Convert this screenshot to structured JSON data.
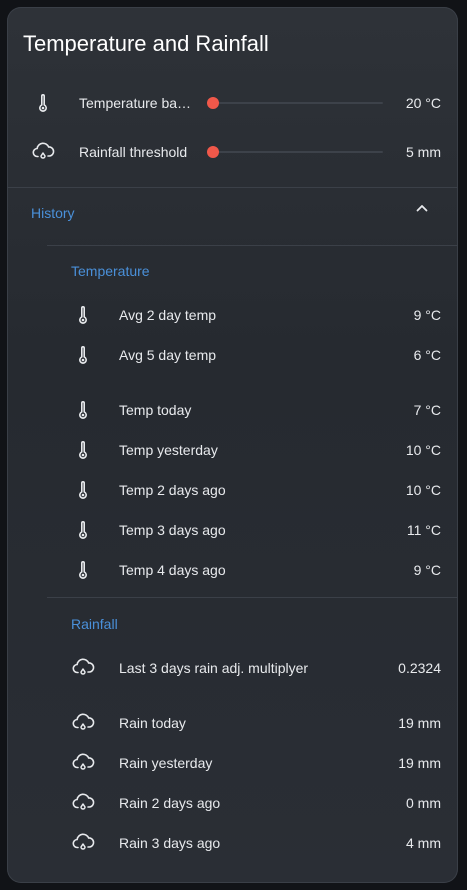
{
  "card": {
    "title": "Temperature and Rainfall"
  },
  "controls": [
    {
      "label": "Temperature ba…",
      "value": "20 °C",
      "icon": "thermometer-icon",
      "slider_fraction": 0.0
    },
    {
      "label": "Rainfall threshold",
      "value": "5 mm",
      "icon": "rain-cloud-icon",
      "slider_fraction": 0.0
    }
  ],
  "history": {
    "label": "History",
    "temperature": {
      "label": "Temperature",
      "items": [
        {
          "label": "Avg 2 day temp",
          "value": "9 °C"
        },
        {
          "label": "Avg 5 day temp",
          "value": "6 °C"
        },
        {
          "label": "Temp today",
          "value": "7 °C"
        },
        {
          "label": "Temp yesterday",
          "value": "10 °C"
        },
        {
          "label": "Temp 2 days ago",
          "value": "10 °C"
        },
        {
          "label": "Temp 3 days ago",
          "value": "11 °C"
        },
        {
          "label": "Temp 4 days ago",
          "value": "9 °C"
        }
      ]
    },
    "rainfall": {
      "label": "Rainfall",
      "items": [
        {
          "label": "Last 3 days rain adj. multiplyer",
          "value": "0.2324"
        },
        {
          "label": "Rain today",
          "value": "19 mm"
        },
        {
          "label": "Rain yesterday",
          "value": "19 mm"
        },
        {
          "label": "Rain 2 days ago",
          "value": "0 mm"
        },
        {
          "label": "Rain 3 days ago",
          "value": "4 mm"
        }
      ]
    }
  },
  "colors": {
    "accent": "#4a90d9",
    "slider_thumb": "#f0584a"
  }
}
